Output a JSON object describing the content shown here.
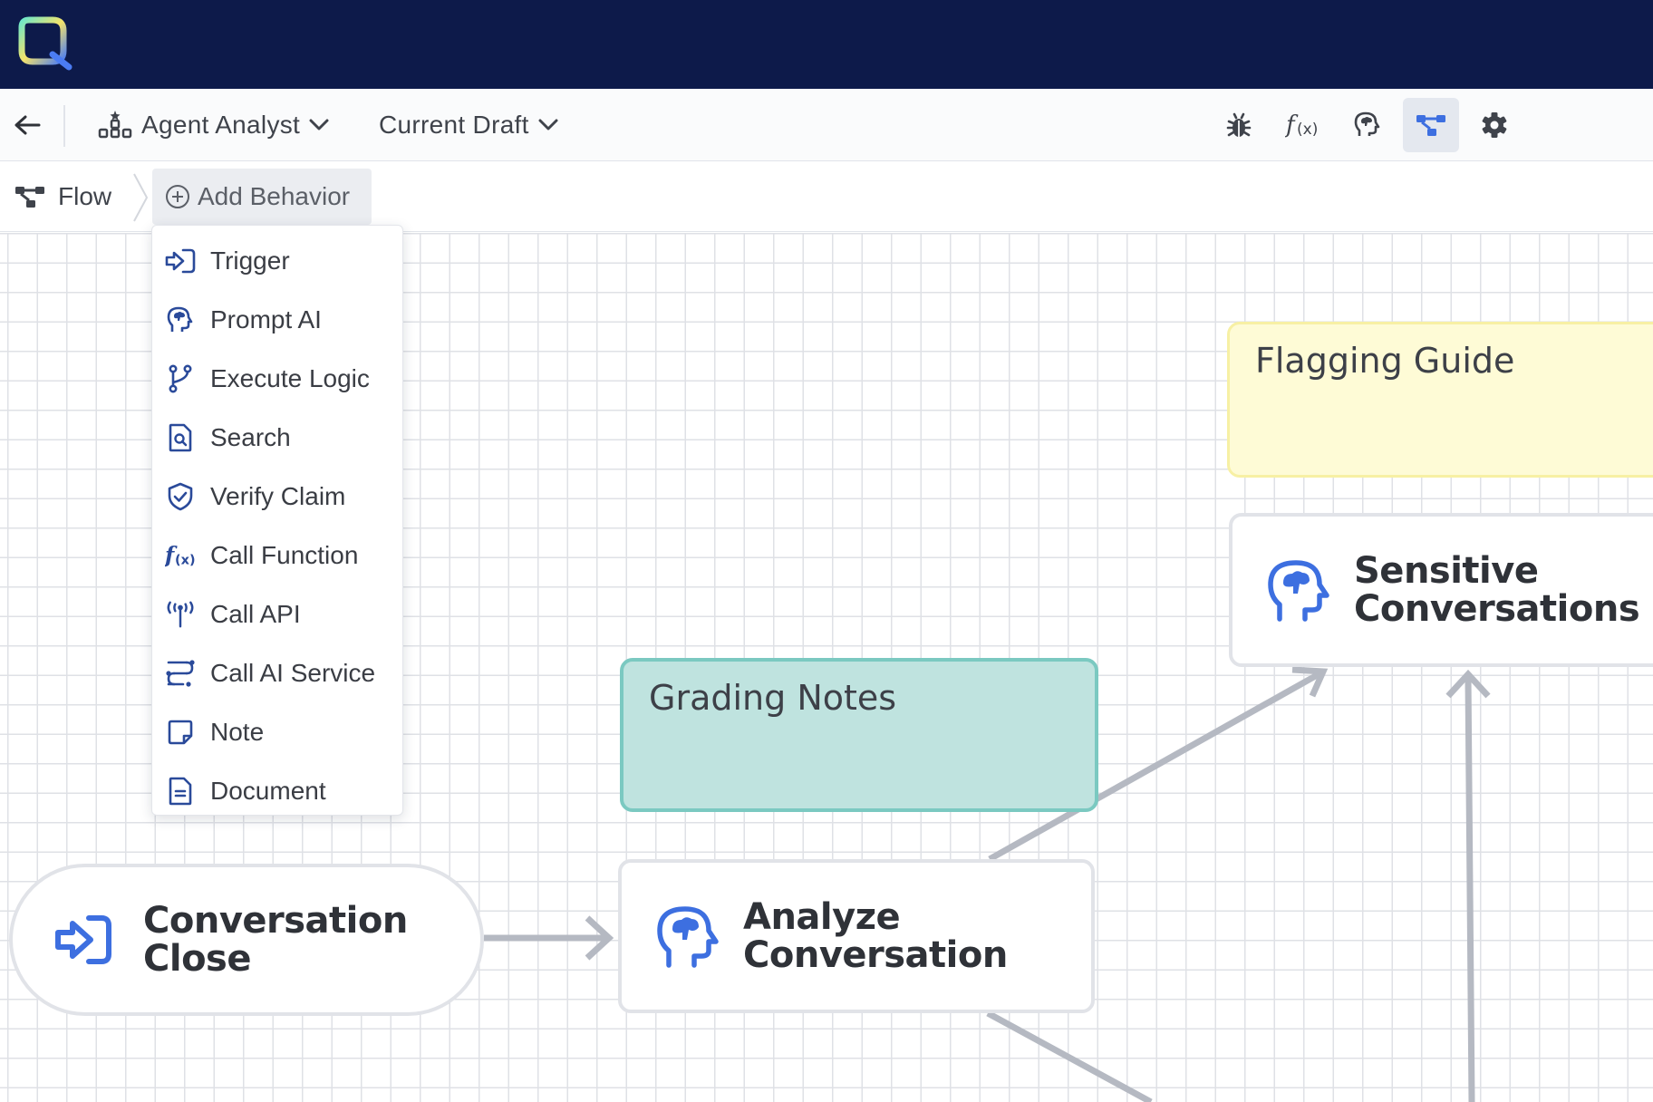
{
  "colors": {
    "topbar": "#0d1a4a",
    "accent_blue": "#3d6fe0",
    "icon_navy": "#2a4a9a",
    "note_yellow": "#fefbd6",
    "note_teal": "#bfe3df",
    "edge_gray": "#b5b9c2"
  },
  "app": {
    "logo_icon": "app-logo-icon"
  },
  "toolbar": {
    "back_icon": "arrow-left-icon",
    "agent_dropdown": {
      "icon": "agent-icon",
      "label": "Agent Analyst"
    },
    "version_dropdown": {
      "label": "Current Draft"
    },
    "actions": [
      {
        "name": "debug",
        "icon": "bug-icon",
        "active": false
      },
      {
        "name": "functions",
        "icon": "function-icon",
        "active": false
      },
      {
        "name": "prompt-ai",
        "icon": "brain-head-icon",
        "active": false
      },
      {
        "name": "flow",
        "icon": "flow-icon",
        "active": true
      },
      {
        "name": "settings",
        "icon": "gear-icon",
        "active": false
      }
    ]
  },
  "breadcrumb": {
    "flow_label": "Flow",
    "add_behavior_label": "Add Behavior"
  },
  "add_behavior_menu": {
    "items": [
      {
        "label": "Trigger",
        "icon": "trigger-icon"
      },
      {
        "label": "Prompt AI",
        "icon": "brain-head-icon"
      },
      {
        "label": "Execute Logic",
        "icon": "branch-icon"
      },
      {
        "label": "Search",
        "icon": "document-search-icon"
      },
      {
        "label": "Verify Claim",
        "icon": "shield-check-icon"
      },
      {
        "label": "Call Function",
        "icon": "function-icon"
      },
      {
        "label": "Call API",
        "icon": "antenna-icon"
      },
      {
        "label": "Call AI Service",
        "icon": "ai-service-icon"
      },
      {
        "label": "Note",
        "icon": "note-icon"
      },
      {
        "label": "Document",
        "icon": "document-icon"
      }
    ]
  },
  "canvas": {
    "notes": [
      {
        "title": "Flagging Guide",
        "color": "#fefbd6"
      },
      {
        "title": "Grading Notes",
        "color": "#bfe3df"
      }
    ],
    "nodes": [
      {
        "title_line1": "Conversation",
        "title_line2": "Close",
        "type": "trigger",
        "icon": "trigger-icon"
      },
      {
        "title_line1": "Analyze",
        "title_line2": "Conversation",
        "type": "prompt-ai",
        "icon": "brain-head-icon"
      },
      {
        "title_line1": "Sensitive",
        "title_line2": "Conversations",
        "type": "prompt-ai",
        "icon": "brain-head-icon"
      }
    ]
  }
}
